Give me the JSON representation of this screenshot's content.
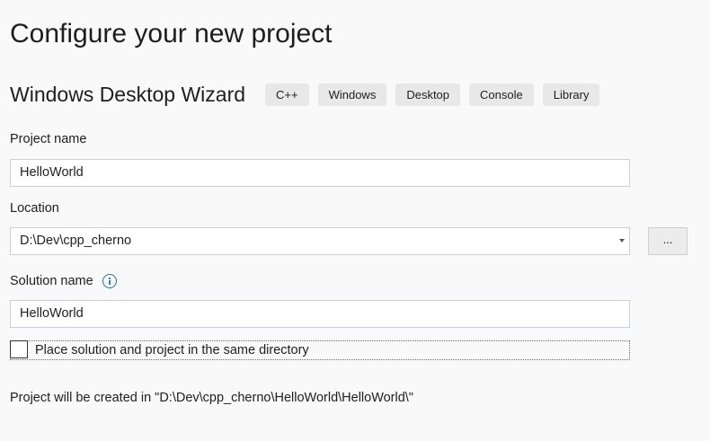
{
  "page": {
    "title": "Configure your new project"
  },
  "template": {
    "name": "Windows Desktop Wizard",
    "tags": [
      "C++",
      "Windows",
      "Desktop",
      "Console",
      "Library"
    ]
  },
  "form": {
    "project_name": {
      "label": "Project name",
      "value": "HelloWorld"
    },
    "location": {
      "label": "Location",
      "value": "D:\\Dev\\cpp_cherno",
      "browse_label": "..."
    },
    "solution_name": {
      "label": "Solution name",
      "value": "HelloWorld",
      "info_icon": "info-icon"
    },
    "same_directory": {
      "label": "Place solution and project in the same directory",
      "checked": false
    },
    "created_in": "Project will be created in \"D:\\Dev\\cpp_cherno\\HelloWorld\\HelloWorld\\\""
  },
  "colors": {
    "background": "#f9f9f9",
    "tag_background": "#e8e8e8",
    "input_border": "#cccedb",
    "info_accent": "#1a73b8"
  }
}
